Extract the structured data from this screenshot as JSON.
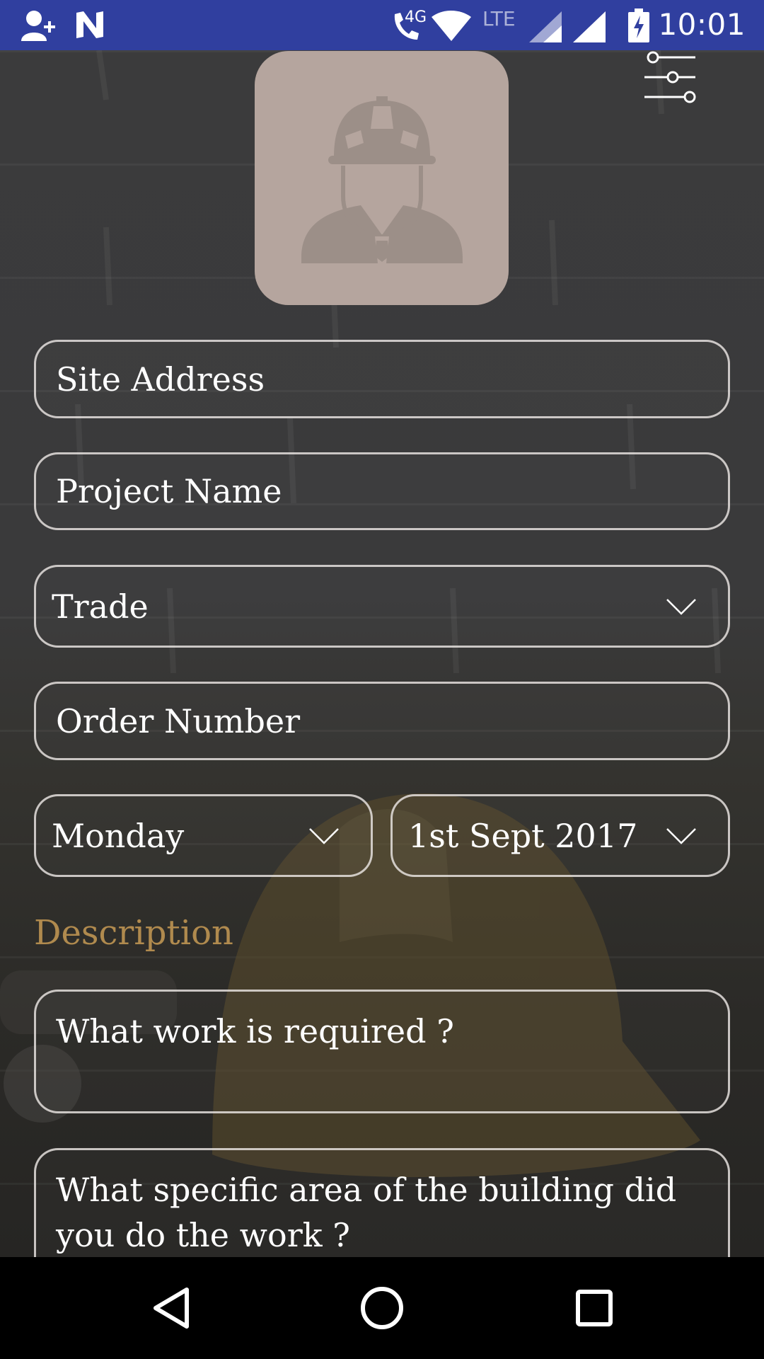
{
  "status_bar": {
    "time": "10:01",
    "network_4g": "4G",
    "network_lte": "LTE",
    "background_color": "#303f9f",
    "icons": [
      "person-add-icon",
      "n-app-icon",
      "phone-call-icon",
      "wifi-icon",
      "signal-icon",
      "battery-charging-icon"
    ]
  },
  "header": {
    "avatar_icon": "construction-worker-icon",
    "filter_icon": "sliders-icon"
  },
  "form": {
    "site_address_placeholder": "Site Address",
    "project_name_placeholder": "Project Name",
    "trade_value": "Trade",
    "order_number_placeholder": "Order Number",
    "day_value": "Monday",
    "date_value": "1st Sept 2017",
    "description_label": "Description",
    "work_required_placeholder": "What work is required ?",
    "specific_area_placeholder": "What specific area of the building did you do the work ?"
  },
  "colors": {
    "accent_label": "#b08a4e",
    "avatar_bg": "#b5a59e",
    "field_border": "#ebe6e4"
  },
  "nav_bar": {
    "icons": [
      "back-icon",
      "home-icon",
      "recents-icon"
    ]
  }
}
